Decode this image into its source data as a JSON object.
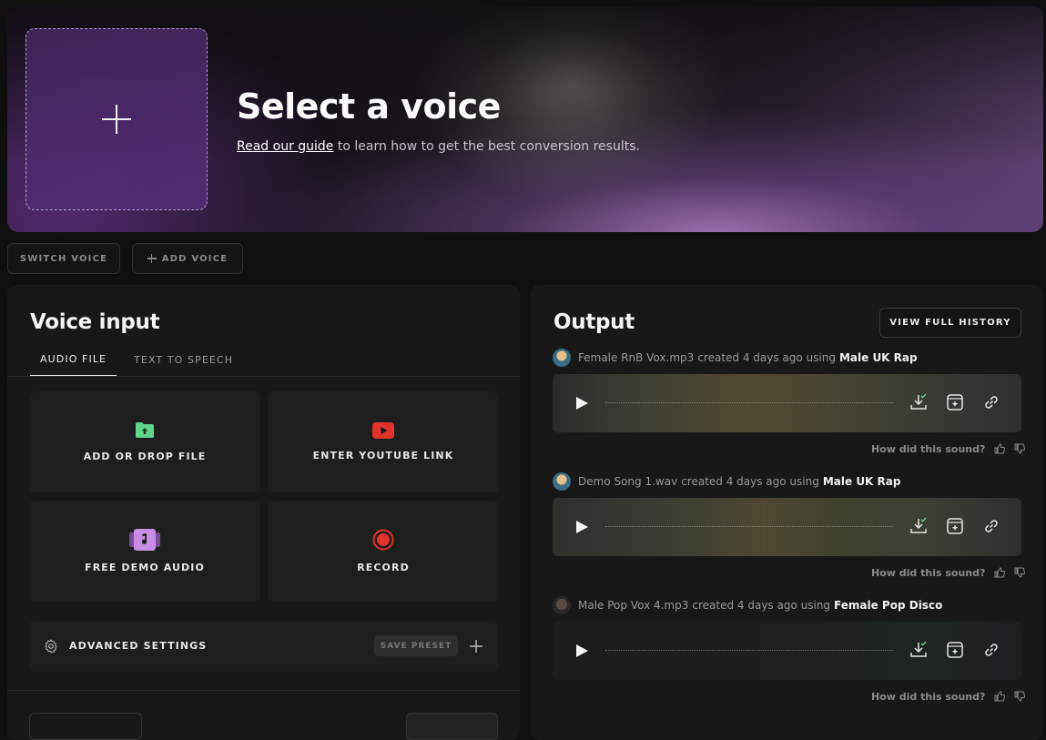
{
  "hero": {
    "title": "Select a voice",
    "guide_link": "Read our guide",
    "subtitle_rest": " to learn how to get the best conversion results."
  },
  "actions": {
    "switch_voice": "SWITCH VOICE",
    "add_voice": "ADD VOICE"
  },
  "voice_input": {
    "title": "Voice input",
    "tabs": [
      {
        "label": "AUDIO FILE",
        "active": true
      },
      {
        "label": "TEXT TO SPEECH",
        "active": false
      }
    ],
    "cards": [
      {
        "label": "ADD OR DROP FILE",
        "icon": "folder-upload-icon",
        "color": "#5fd48a"
      },
      {
        "label": "ENTER YOUTUBE LINK",
        "icon": "youtube-icon",
        "color": "#e2332b"
      },
      {
        "label": "FREE DEMO AUDIO",
        "icon": "music-note-icon",
        "color": "#c98de6"
      },
      {
        "label": "RECORD",
        "icon": "record-icon",
        "color": "#e2332b"
      }
    ],
    "advanced_settings": "ADVANCED SETTINGS",
    "save_preset": "SAVE PRESET"
  },
  "output": {
    "title": "Output",
    "history_button": "VIEW FULL HISTORY",
    "rating_prompt": "How did this sound?",
    "items": [
      {
        "file": "Female RnB Vox.mp3",
        "created": "created 4 days ago using",
        "voice": "Male UK Rap"
      },
      {
        "file": "Demo Song 1.wav",
        "created": "created 4 days ago using",
        "voice": "Male UK Rap"
      },
      {
        "file": "Male Pop Vox 4.mp3",
        "created": "created 4 days ago using",
        "voice": "Female Pop Disco"
      }
    ]
  }
}
